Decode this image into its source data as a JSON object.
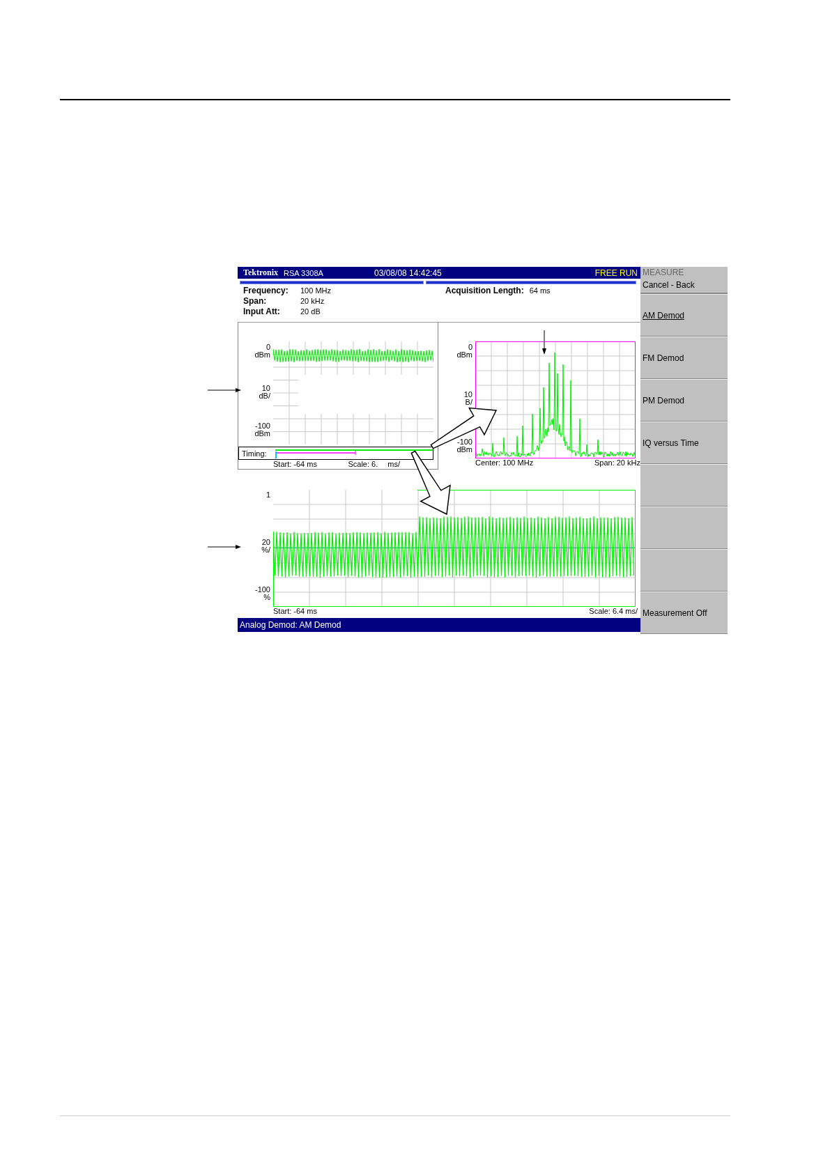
{
  "title_bar": {
    "brand": "Tektronix",
    "model": "RSA 3308A",
    "datetime": "03/08/08 14:42:45",
    "status": "FREE RUN"
  },
  "settings": [
    {
      "label": "Frequency:",
      "value": "100 MHz"
    },
    {
      "label": "Span:",
      "value": "20 kHz"
    },
    {
      "label": "Input Att:",
      "value": "20 dB"
    }
  ],
  "acquisition": {
    "label": "Acquisition Length:",
    "value": "64 ms"
  },
  "overview_panel": {
    "ticks": [
      {
        "value": "0",
        "unit": "dBm"
      },
      {
        "value": "10",
        "unit": "dB/"
      },
      {
        "value": "-100",
        "unit": "dBm"
      }
    ],
    "timing_label": "Timing:",
    "start": "Start: -64 ms",
    "scale_left": "Scale: 6.",
    "scale_right": "ms/"
  },
  "spectrum_panel": {
    "ticks": [
      {
        "value": "0",
        "unit": "dBm"
      },
      {
        "value": "10",
        "unit": "B/"
      },
      {
        "value": "-100",
        "unit": "dBm"
      }
    ],
    "center": "Center: 100 MHz",
    "span": "Span: 20 kHz"
  },
  "demod_panel": {
    "ticks": [
      {
        "value": "1"
      },
      {
        "value": "20",
        "unit": "%/"
      },
      {
        "value": "-100",
        "unit": "%"
      }
    ],
    "start": "Start: -64 ms",
    "scale": "Scale: 6.4 ms/"
  },
  "status_bar": "Analog Demod: AM Demod",
  "menu": {
    "title": "MEASURE",
    "back": "Cancel - Back"
  },
  "softkeys": [
    {
      "kind": "label",
      "label": "AM Demod",
      "selected": true
    },
    {
      "kind": "label",
      "label": "FM Demod",
      "selected": false
    },
    {
      "kind": "label",
      "label": "PM Demod",
      "selected": false
    },
    {
      "kind": "label",
      "label": "IQ versus Time",
      "selected": false
    },
    {
      "kind": "blank"
    },
    {
      "kind": "blank"
    },
    {
      "kind": "blank"
    },
    {
      "kind": "label",
      "label": "Measurement Off",
      "selected": false
    }
  ]
}
